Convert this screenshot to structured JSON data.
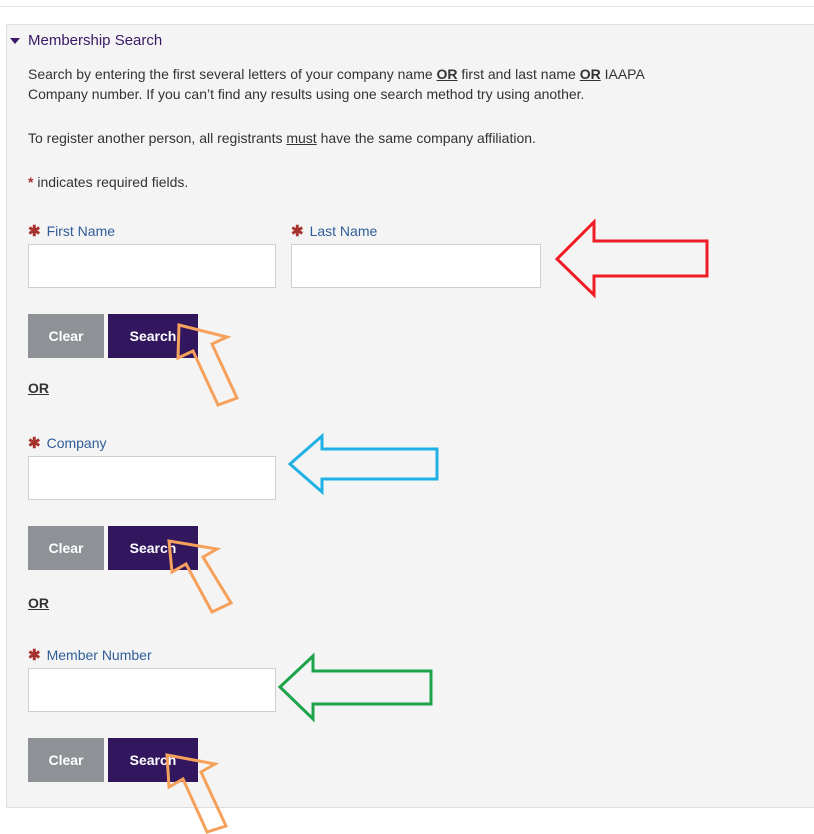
{
  "section": {
    "title": "Membership Search",
    "intro_part1": "Search by entering the first several letters of your company name ",
    "or_1": "OR",
    "intro_part2": " first and last name ",
    "or_2": "OR",
    "intro_part3": " IAAPA",
    "intro_line2": "Company number.  If you can’t find any results using one search method try using another.",
    "note_part1": "To register another person, all registrants ",
    "note_must": "must",
    "note_part2": " have the same company affiliation.",
    "required_star": "*",
    "required_text": " indicates required fields."
  },
  "name_search": {
    "first_name_label": "First Name",
    "last_name_label": "Last Name",
    "first_name_value": "",
    "last_name_value": "",
    "clear_label": "Clear",
    "search_label": "Search"
  },
  "or_divider_1": "OR",
  "company_search": {
    "company_label": "Company",
    "company_value": "",
    "clear_label": "Clear",
    "search_label": "Search"
  },
  "or_divider_2": "OR",
  "member_search": {
    "member_number_label": "Member Number",
    "member_number_value": "",
    "clear_label": "Clear",
    "search_label": "Search"
  },
  "annotation_colors": {
    "red": "#ee1c24",
    "blue": "#1fb1e6",
    "green": "#1fa34a",
    "orange": "#f5a15b"
  }
}
